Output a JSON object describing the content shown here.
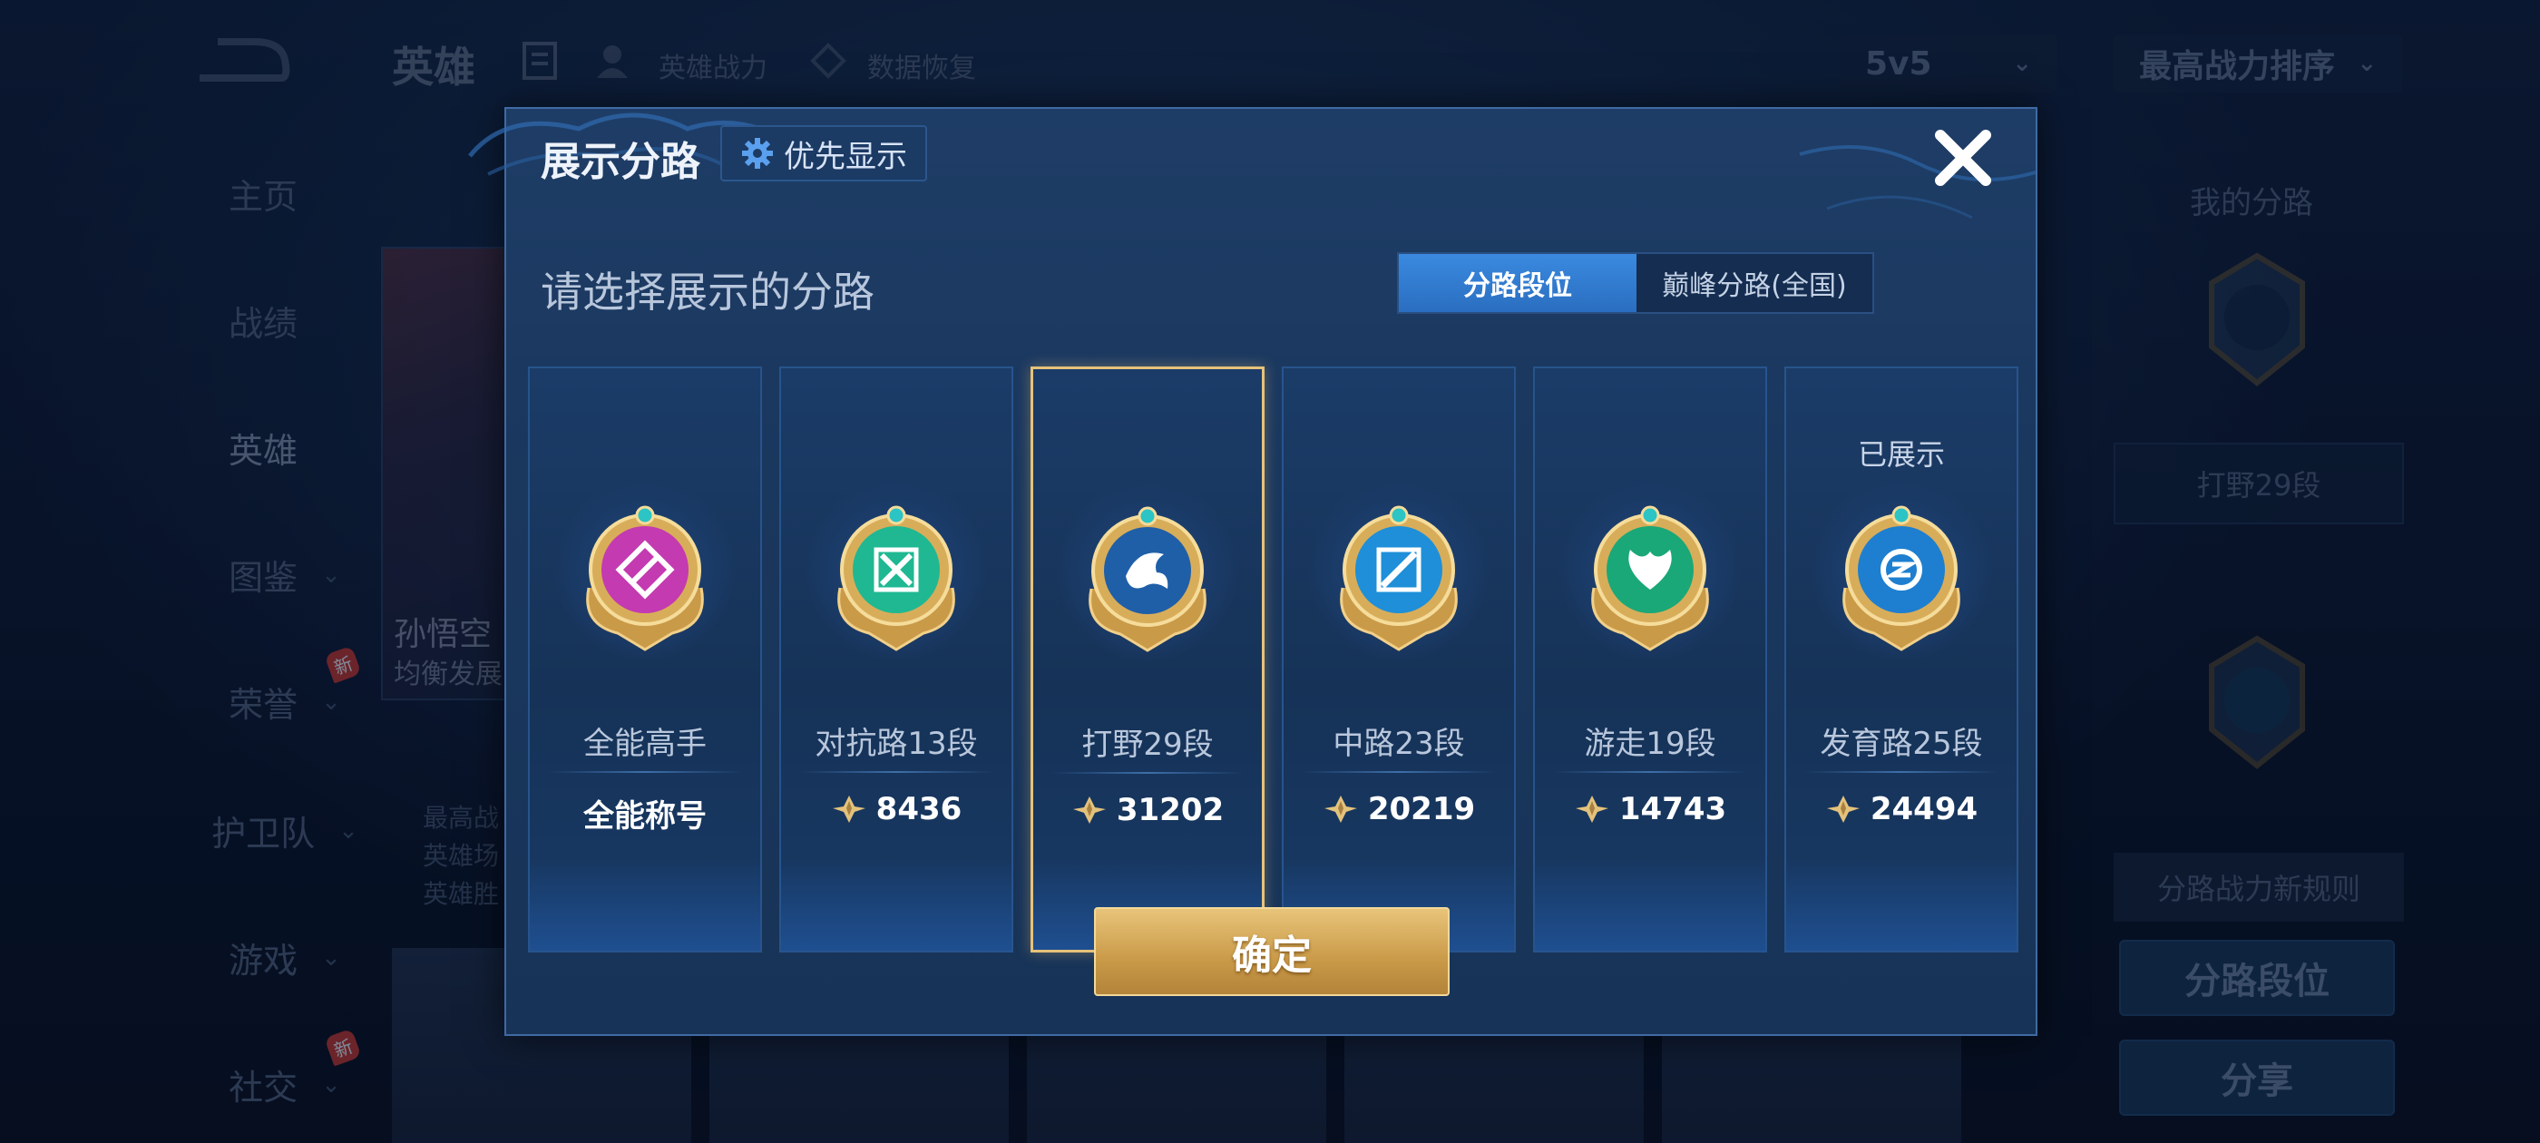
{
  "background": {
    "header": {
      "title": "英雄",
      "links": [
        "英雄战力",
        "数据恢复"
      ],
      "mode_select": "5v5",
      "sort_select": "最高战力排序"
    },
    "sidebar": [
      {
        "label": "主页"
      },
      {
        "label": "战绩"
      },
      {
        "label": "英雄"
      },
      {
        "label": "图鉴"
      },
      {
        "label": "荣誉",
        "badge": "新"
      },
      {
        "label": "护卫队"
      },
      {
        "label": "游戏"
      },
      {
        "label": "社交",
        "badge": "新"
      }
    ],
    "hero": {
      "name": "孙悟空",
      "subtitle": "均衡发展",
      "lines": [
        "最高战",
        "英雄场",
        "英雄胜"
      ]
    },
    "right_panel": {
      "title": "我的分路",
      "lane_box": "打野29段",
      "rules": "分路战力新规则",
      "btn_segment": "分路段位",
      "btn_share": "分享"
    }
  },
  "modal": {
    "title": "展示分路",
    "priority_label": "优先显示",
    "subtitle": "请选择展示的分路",
    "tabs": [
      {
        "label": "分路段位",
        "active": true
      },
      {
        "label": "巅峰分路(全国)",
        "active": false
      }
    ],
    "lanes": [
      {
        "name": "全能高手",
        "value": "全能称号",
        "shows_power_icon": false,
        "selected": false,
        "shown": false,
        "emblem": "allround-emblem-icon",
        "color": "#c43ab0"
      },
      {
        "name": "对抗路13段",
        "value": "8436",
        "shows_power_icon": true,
        "selected": false,
        "shown": false,
        "emblem": "clash-lane-emblem-icon",
        "color": "#1fb892"
      },
      {
        "name": "打野29段",
        "value": "31202",
        "shows_power_icon": true,
        "selected": true,
        "shown": false,
        "emblem": "jungle-emblem-icon",
        "color": "#1f5fa8"
      },
      {
        "name": "中路23段",
        "value": "20219",
        "shows_power_icon": true,
        "selected": false,
        "shown": false,
        "emblem": "mid-lane-emblem-icon",
        "color": "#1e8fd8"
      },
      {
        "name": "游走19段",
        "value": "14743",
        "shows_power_icon": true,
        "selected": false,
        "shown": false,
        "emblem": "roam-emblem-icon",
        "color": "#1aa878"
      },
      {
        "name": "发育路25段",
        "value": "24494",
        "shows_power_icon": true,
        "selected": false,
        "shown": true,
        "emblem": "farm-lane-emblem-icon",
        "color": "#1e7fd0"
      }
    ],
    "shown_label": "已展示",
    "confirm_label": "确定"
  }
}
